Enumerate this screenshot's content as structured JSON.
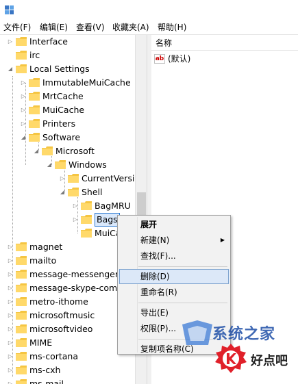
{
  "menubar": [
    "文件(F)",
    "编辑(E)",
    "查看(V)",
    "收藏夹(A)",
    "帮助(H)"
  ],
  "tree": [
    {
      "label": "Interface",
      "arrow": "right"
    },
    {
      "label": "irc",
      "arrow": "none"
    },
    {
      "label": "Local Settings",
      "arrow": "down"
    },
    {
      "label": "ImmutableMuiCache",
      "arrow": "right"
    },
    {
      "label": "MrtCache",
      "arrow": "right"
    },
    {
      "label": "MuiCache",
      "arrow": "right"
    },
    {
      "label": "Printers",
      "arrow": "right"
    },
    {
      "label": "Software",
      "arrow": "down"
    },
    {
      "label": "Microsoft",
      "arrow": "down"
    },
    {
      "label": "Windows",
      "arrow": "down"
    },
    {
      "label": "CurrentVersion",
      "arrow": "right"
    },
    {
      "label": "Shell",
      "arrow": "down"
    },
    {
      "label": "BagMRU",
      "arrow": "right"
    },
    {
      "label": "Bags",
      "arrow": "right",
      "selected": true
    },
    {
      "label": "MuiCache",
      "arrow": "none"
    },
    {
      "label": "magnet",
      "arrow": "right"
    },
    {
      "label": "mailto",
      "arrow": "right"
    },
    {
      "label": "message-messenger",
      "arrow": "right"
    },
    {
      "label": "message-skype-com",
      "arrow": "right"
    },
    {
      "label": "metro-ithome",
      "arrow": "right"
    },
    {
      "label": "microsoftmusic",
      "arrow": "right"
    },
    {
      "label": "microsoftvideo",
      "arrow": "right"
    },
    {
      "label": "MIME",
      "arrow": "right"
    },
    {
      "label": "ms-cortana",
      "arrow": "right"
    },
    {
      "label": "ms-cxh",
      "arrow": "right"
    },
    {
      "label": "ms-mail",
      "arrow": "right"
    }
  ],
  "right_pane": {
    "column_name": "名称",
    "values": [
      {
        "icon": "ab",
        "label": "(默认)"
      }
    ]
  },
  "context_menu": [
    {
      "label": "展开",
      "bold": true
    },
    {
      "label": "新建(N)",
      "submenu": true
    },
    {
      "label": "查找(F)..."
    },
    {
      "sep": true
    },
    {
      "label": "删除(D)",
      "hover": true
    },
    {
      "label": "重命名(R)"
    },
    {
      "sep": true
    },
    {
      "label": "导出(E)"
    },
    {
      "label": "权限(P)..."
    },
    {
      "sep": true
    },
    {
      "label": "复制项名称(C)"
    }
  ],
  "watermark": {
    "text1": "系统之家",
    "text2": "好点吧"
  },
  "colors": {
    "selection_border": "#2b78d0",
    "folder": "#f5c542",
    "menu_hover": "#dce8f8"
  }
}
